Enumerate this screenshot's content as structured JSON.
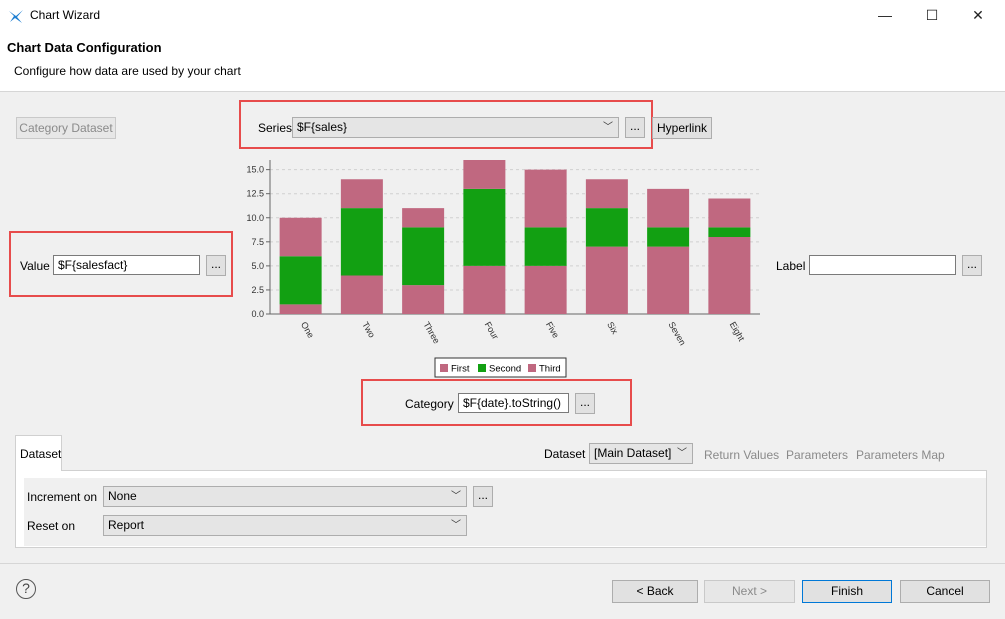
{
  "window": {
    "title": "Chart Wizard",
    "controls": {
      "minimize": "—",
      "maximize": "☐",
      "close": "✕"
    }
  },
  "header": {
    "title": "Chart Data Configuration",
    "subtitle": "Configure how data are used by your chart"
  },
  "category_dataset_button": "Category Dataset",
  "series": {
    "label": "Series",
    "value": "$F{sales}",
    "browse": "...",
    "hyperlink": "Hyperlink"
  },
  "value": {
    "label": "Value",
    "value": "$F{salesfact}",
    "browse": "..."
  },
  "label_field": {
    "label": "Label",
    "value": "",
    "browse": "..."
  },
  "category": {
    "label": "Category",
    "value": "$F{date}.toString()",
    "browse": "..."
  },
  "chart_data": {
    "type": "bar",
    "stacked": true,
    "categories": [
      "One",
      "Two",
      "Three",
      "Four",
      "Five",
      "Six",
      "Seven",
      "Eight"
    ],
    "series": [
      {
        "name": "First",
        "color": "#c06880",
        "values": [
          1,
          4,
          3,
          5,
          5,
          7,
          7,
          8
        ]
      },
      {
        "name": "Second",
        "color": "#12a012",
        "values": [
          5,
          7,
          6,
          8,
          4,
          4,
          2,
          1
        ]
      },
      {
        "name": "Third",
        "color": "#c06880",
        "values": [
          4,
          3,
          2,
          3,
          6,
          3,
          4,
          3
        ]
      }
    ],
    "yticks": [
      "0.0",
      "2.5",
      "5.0",
      "7.5",
      "10.0",
      "12.5",
      "15.0"
    ],
    "ylim": [
      0,
      16
    ],
    "grid": true,
    "legend_position": "bottom"
  },
  "dataset_tab": {
    "label": "Dataset"
  },
  "dataset_select": {
    "label": "Dataset",
    "value": "[Main Dataset]"
  },
  "links": {
    "return_values": "Return Values",
    "parameters": "Parameters",
    "parameters_map": "Parameters Map"
  },
  "increment_on": {
    "label": "Increment on",
    "value": "None",
    "browse": "..."
  },
  "reset_on": {
    "label": "Reset on",
    "value": "Report"
  },
  "help": "?",
  "buttons": {
    "back": "< Back",
    "next": "Next >",
    "finish": "Finish",
    "cancel": "Cancel"
  },
  "colors": {
    "accent": "#0078d7",
    "highlight": "#e74c4c",
    "bar_pink": "#c06880",
    "bar_green": "#12a012"
  }
}
